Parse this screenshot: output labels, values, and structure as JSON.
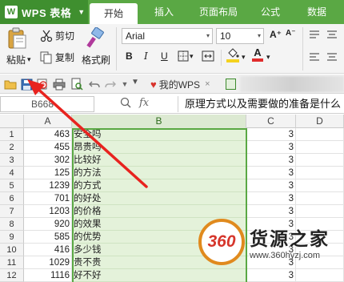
{
  "app": {
    "logo_text": "W",
    "name": "WPS 表格",
    "dropdown": "▼"
  },
  "tabs": [
    {
      "label": "开始",
      "active": true
    },
    {
      "label": "插入",
      "active": false
    },
    {
      "label": "页面布局",
      "active": false
    },
    {
      "label": "公式",
      "active": false
    },
    {
      "label": "数据",
      "active": false
    }
  ],
  "ribbon": {
    "paste_label": "粘贴",
    "paste_dropdown": "▾",
    "cut_label": "剪切",
    "copy_label": "复制",
    "format_painter_label": "格式刷",
    "font_name": "Arial",
    "font_size": "10",
    "grow_font": "A⁺",
    "shrink_font": "A⁻",
    "bold": "B",
    "italic": "I",
    "underline": "U",
    "dropdown": "▾",
    "font_color_letter": "A",
    "colors": {
      "fill": "#f4d21f",
      "font": "#e02c2c",
      "accent": "#5aa844"
    }
  },
  "quick_access": {
    "undo_redo_more": "▼",
    "my_wps": "我的WPS"
  },
  "formula_bar": {
    "cell_ref": "B668",
    "fx": "fx",
    "content": "原理方式以及需要做的准备是什么"
  },
  "grid": {
    "columns": [
      "A",
      "B",
      "C",
      "D"
    ],
    "selected_column": "B",
    "rows": [
      {
        "n": "1",
        "a": "463",
        "b": "安全吗",
        "c": "3"
      },
      {
        "n": "2",
        "a": "455",
        "b": "昂贵吗",
        "c": "3"
      },
      {
        "n": "3",
        "a": "302",
        "b": "比较好",
        "c": "3"
      },
      {
        "n": "4",
        "a": "125",
        "b": "的方法",
        "c": "3"
      },
      {
        "n": "5",
        "a": "1239",
        "b": "的方式",
        "c": "3"
      },
      {
        "n": "6",
        "a": "701",
        "b": "的好处",
        "c": "3"
      },
      {
        "n": "7",
        "a": "1203",
        "b": "的价格",
        "c": "3"
      },
      {
        "n": "8",
        "a": "920",
        "b": "的效果",
        "c": "3"
      },
      {
        "n": "9",
        "a": "585",
        "b": "的优势",
        "c": "3"
      },
      {
        "n": "10",
        "a": "416",
        "b": "多少钱",
        "c": "3"
      },
      {
        "n": "11",
        "a": "1029",
        "b": "贵不贵",
        "c": "3"
      },
      {
        "n": "12",
        "a": "1116",
        "b": "好不好",
        "c": "3"
      }
    ]
  },
  "watermark": {
    "badge": "360",
    "title": "货源之家",
    "url": "www.360hyzj.com"
  }
}
